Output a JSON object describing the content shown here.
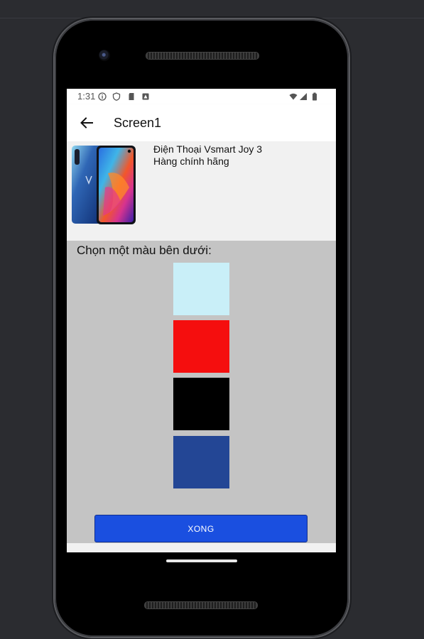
{
  "status_bar": {
    "time": "1:31",
    "left_icons": [
      "info-icon",
      "shield-icon",
      "sd-card-icon",
      "app-notification-icon"
    ],
    "right_icons": [
      "wifi-icon",
      "cell-signal-icon",
      "battery-icon"
    ]
  },
  "app_bar": {
    "title": "Screen1",
    "back_icon": "arrow-left-icon"
  },
  "product": {
    "name": "Điện Thoại Vsmart Joy 3",
    "subtitle": "Hàng chính hãng"
  },
  "color_picker": {
    "label": "Chọn một màu bên dưới:",
    "colors": [
      {
        "name": "light-blue",
        "hex": "#c9eff8"
      },
      {
        "name": "red",
        "hex": "#f50e0e"
      },
      {
        "name": "black",
        "hex": "#000000"
      },
      {
        "name": "navy-blue",
        "hex": "#234695"
      }
    ]
  },
  "done_button": {
    "label": "XONG",
    "color": "#1a4fe0"
  }
}
